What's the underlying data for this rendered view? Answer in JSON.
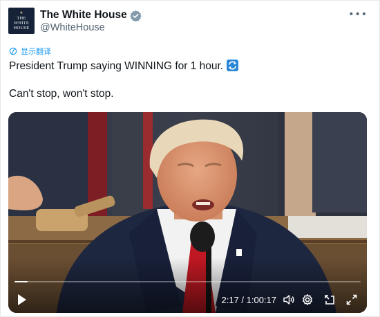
{
  "author": {
    "display_name": "The White House",
    "handle": "@WhiteHouse",
    "avatar_text": [
      "THE",
      "WHITE",
      "HOUSE"
    ],
    "verified": true
  },
  "translate_label": "显示翻译",
  "tweet": {
    "line1": "President Trump saying WINNING for 1 hour.",
    "line2": "Can't stop, won't stop."
  },
  "video": {
    "current_time": "2:17",
    "duration": "1:00:17",
    "time_display": "2:17 / 1:00:17",
    "progress_fraction": 0.038
  },
  "colors": {
    "accent": "#1d9bf0",
    "verified_badge": "#829aab",
    "avatar_bg": "#152238"
  }
}
